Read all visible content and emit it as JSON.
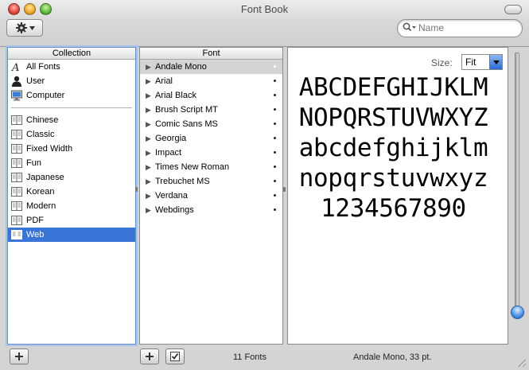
{
  "window": {
    "title": "Font Book"
  },
  "toolbar": {
    "action_menu_icon": "gear-icon",
    "search_placeholder": "Name",
    "search_icon": "magnifier-icon"
  },
  "collection": {
    "header": "Collection",
    "top_items": [
      {
        "label": "All Fonts",
        "icon": "script-a-icon"
      },
      {
        "label": "User",
        "icon": "user-silhouette-icon"
      },
      {
        "label": "Computer",
        "icon": "computer-monitor-icon"
      }
    ],
    "items": [
      {
        "label": "Chinese",
        "icon": "font-collection-icon"
      },
      {
        "label": "Classic",
        "icon": "font-collection-icon"
      },
      {
        "label": "Fixed Width",
        "icon": "font-collection-icon"
      },
      {
        "label": "Fun",
        "icon": "font-collection-icon"
      },
      {
        "label": "Japanese",
        "icon": "font-collection-icon"
      },
      {
        "label": "Korean",
        "icon": "font-collection-icon"
      },
      {
        "label": "Modern",
        "icon": "font-collection-icon"
      },
      {
        "label": "PDF",
        "icon": "font-collection-icon"
      },
      {
        "label": "Web",
        "icon": "font-collection-icon",
        "selected": true
      }
    ]
  },
  "font": {
    "header": "Font",
    "items": [
      {
        "label": "Andale Mono",
        "selected": true
      },
      {
        "label": "Arial"
      },
      {
        "label": "Arial Black"
      },
      {
        "label": "Brush Script MT"
      },
      {
        "label": "Comic Sans MS"
      },
      {
        "label": "Georgia"
      },
      {
        "label": "Impact"
      },
      {
        "label": "Times New Roman"
      },
      {
        "label": "Trebuchet MS"
      },
      {
        "label": "Verdana"
      },
      {
        "label": "Webdings"
      }
    ]
  },
  "preview": {
    "size_label": "Size:",
    "size_value": "Fit",
    "lines": [
      "ABCDEFGHIJKLM",
      "NOPQRSTUVWXYZ",
      "abcdefghijklm",
      "nopqrstuvwxyz",
      "1234567890"
    ]
  },
  "status": {
    "font_count": "11 Fonts",
    "selected_font_info": "Andale Mono, 33 pt."
  },
  "colors": {
    "selection": "#3875d7",
    "window_bg": "#d4d4d4"
  }
}
